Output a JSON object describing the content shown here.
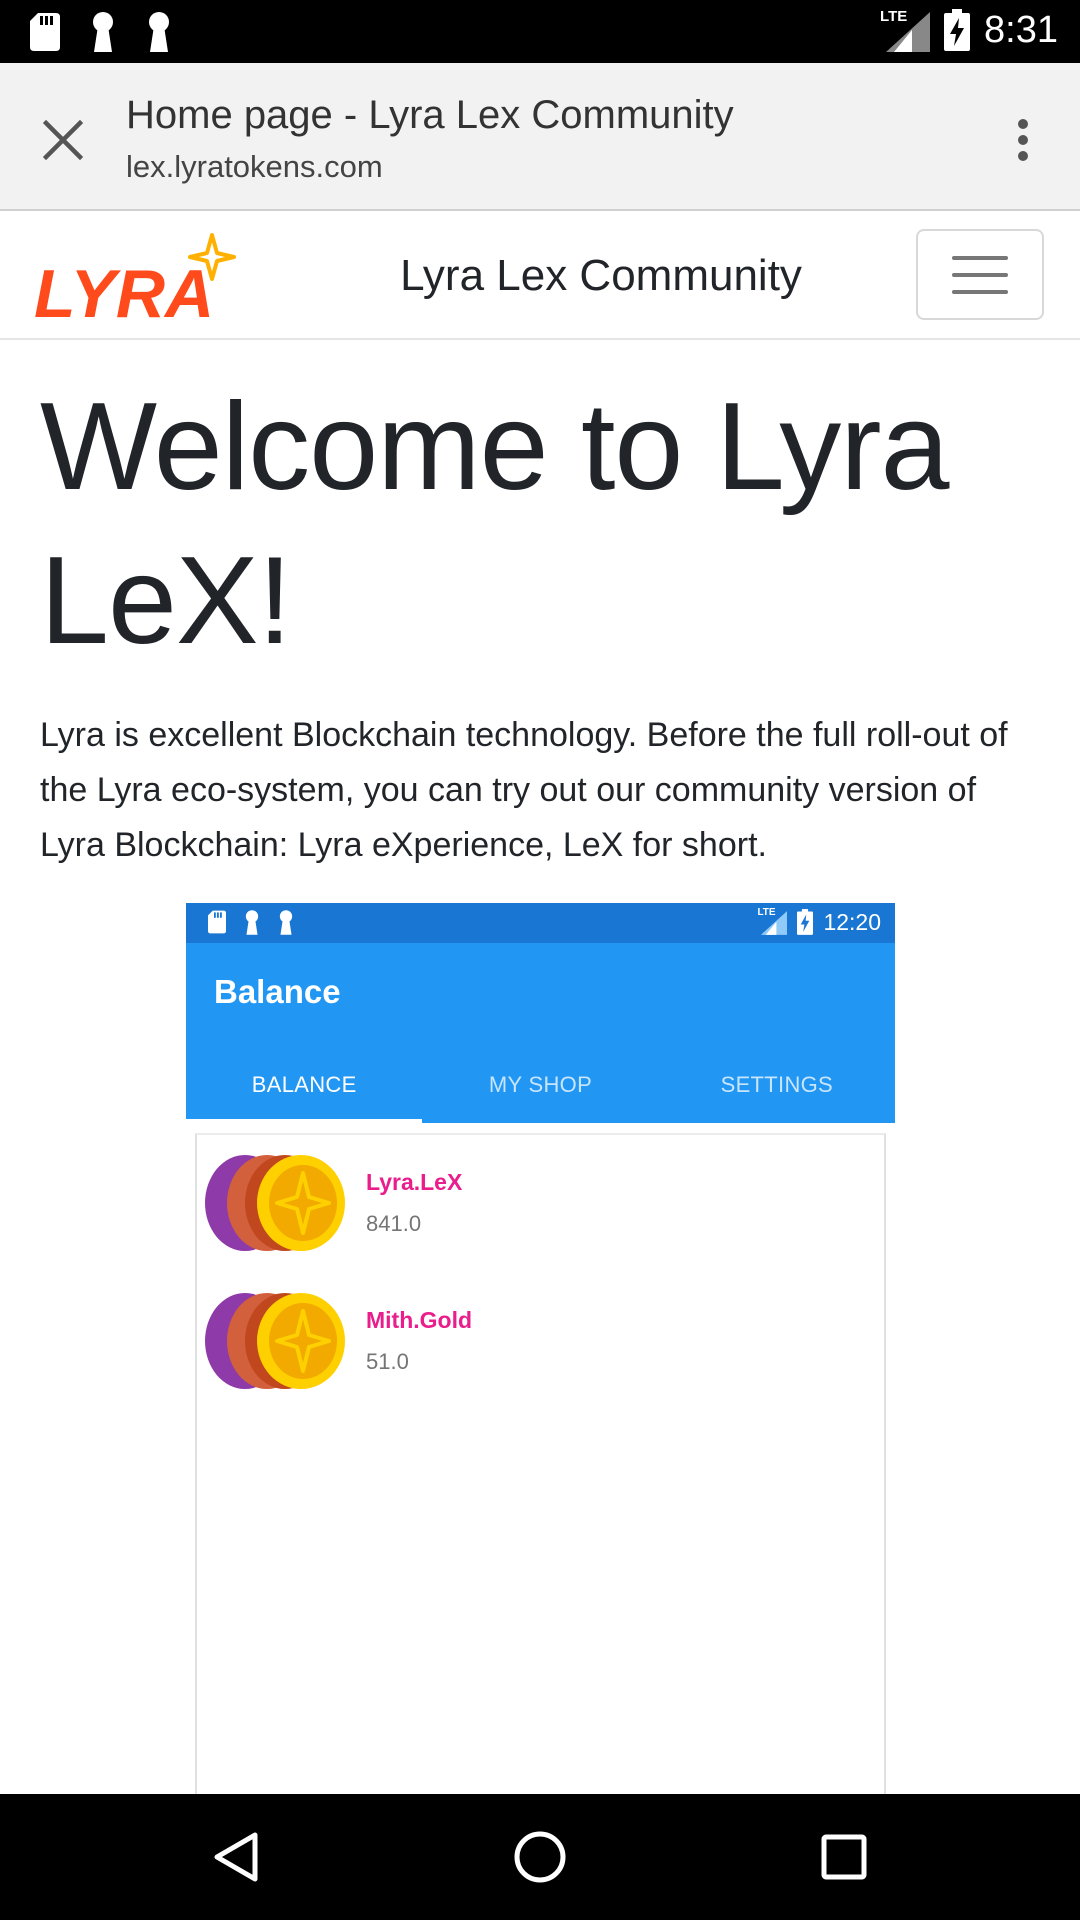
{
  "status_bar": {
    "time": "8:31",
    "network": "LTE",
    "icons": [
      "sd-card-icon",
      "keyhole-icon",
      "keyhole-icon",
      "lte-signal-icon",
      "battery-charging-icon"
    ]
  },
  "tab_toolbar": {
    "title": "Home page - Lyra Lex Community",
    "url": "lex.lyratokens.com",
    "icons": [
      "close-icon",
      "more-vert-icon"
    ]
  },
  "navbar": {
    "logo_text": "LYRA",
    "brand": "Lyra Lex Community",
    "toggler_icon": "hamburger-menu-icon"
  },
  "main": {
    "heading": "Welcome to Lyra LeX!",
    "intro": "Lyra is excellent Blockchain technology. Before the full roll-out of the Lyra eco-system, you can try out our community version of Lyra Blockchain: Lyra eXperience, LeX for short."
  },
  "app_screenshot": {
    "status_time": "12:20",
    "network": "LTE",
    "title": "Balance",
    "tabs": [
      {
        "label": "BALANCE",
        "active": true
      },
      {
        "label": "MY SHOP",
        "active": false
      },
      {
        "label": "SETTINGS",
        "active": false
      }
    ],
    "tokens": [
      {
        "name": "Lyra.LeX",
        "amount": "841.0",
        "icon": "coin-stack-icon"
      },
      {
        "name": "Mith.Gold",
        "amount": "51.0",
        "icon": "coin-stack-icon"
      }
    ]
  },
  "nav_bar": {
    "icons": [
      "back-triangle-icon",
      "home-circle-icon",
      "recents-square-icon"
    ]
  },
  "colors": {
    "accent_blue": "#2196f3",
    "status_blue": "#1976d2",
    "token_name": "#e91e8c",
    "logo_orange": "#ff4a1c",
    "logo_star": "#ffb000"
  }
}
